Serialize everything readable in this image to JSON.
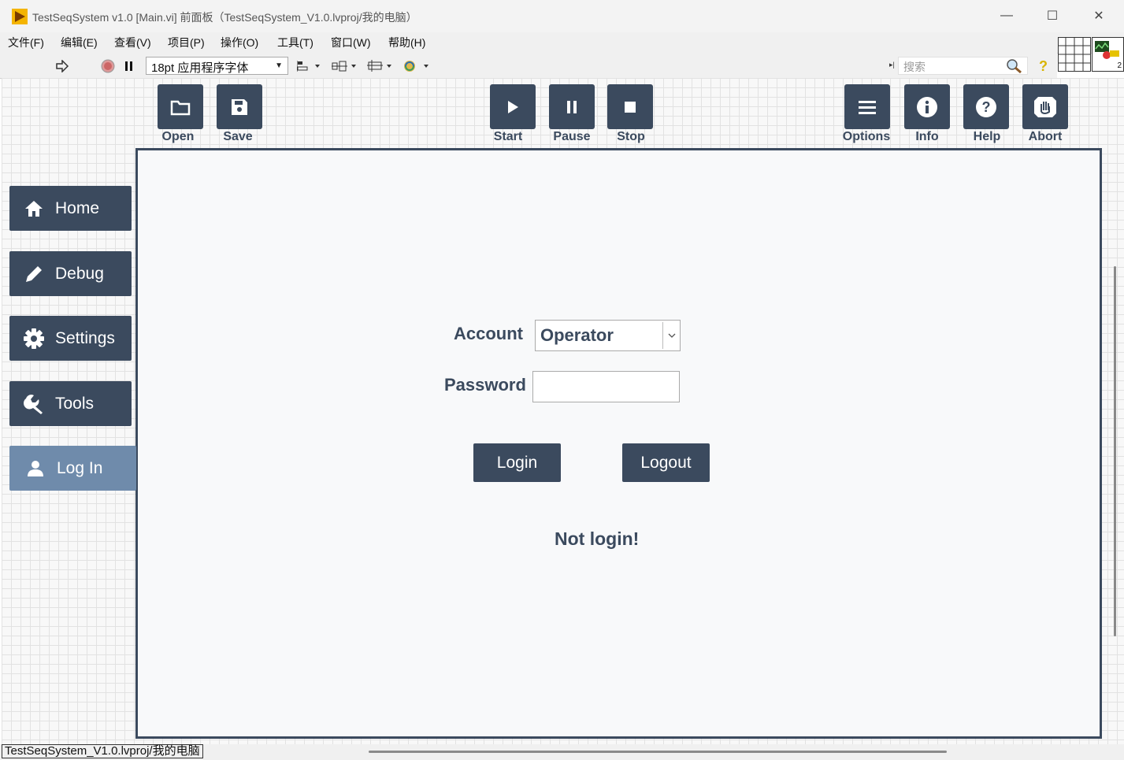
{
  "window": {
    "title": "TestSeqSystem v1.0 [Main.vi] 前面板（TestSeqSystem_V1.0.lvproj/我的电脑）",
    "controls": {
      "minimize": "—",
      "maximize": "☐",
      "close": "✕"
    }
  },
  "menu": [
    "文件(F)",
    "编辑(E)",
    "查看(V)",
    "项目(P)",
    "操作(O)",
    "工具(T)",
    "窗口(W)",
    "帮助(H)"
  ],
  "toolbar": {
    "font": "18pt 应用程序字体",
    "search_placeholder": "搜索",
    "icons": [
      "run-arrow-icon",
      "abort-icon",
      "pause-icon",
      "align-icon",
      "distribute-icon",
      "resize-icon",
      "reorder-icon",
      "search-icon",
      "help-icon"
    ]
  },
  "vi_icon_number": "2",
  "top_buttons": [
    {
      "label": "Open",
      "icon": "folder-icon"
    },
    {
      "label": "Save",
      "icon": "save-icon"
    },
    {
      "label": "Start",
      "icon": "play-icon"
    },
    {
      "label": "Pause",
      "icon": "pause-icon"
    },
    {
      "label": "Stop",
      "icon": "stop-icon"
    },
    {
      "label": "Options",
      "icon": "menu-icon"
    },
    {
      "label": "Info",
      "icon": "info-icon"
    },
    {
      "label": "Help",
      "icon": "question-icon"
    },
    {
      "label": "Abort",
      "icon": "hand-icon"
    }
  ],
  "nav": [
    {
      "label": "Home",
      "icon": "home-icon",
      "active": false
    },
    {
      "label": "Debug",
      "icon": "pencil-icon",
      "active": false
    },
    {
      "label": "Settings",
      "icon": "gear-icon",
      "active": false
    },
    {
      "label": "Tools",
      "icon": "wrench-icon",
      "active": false
    },
    {
      "label": "Log In",
      "icon": "user-icon",
      "active": true
    }
  ],
  "login": {
    "account_label": "Account",
    "account_value": "Operator",
    "password_label": "Password",
    "password_value": "",
    "login_button": "Login",
    "logout_button": "Logout",
    "status": "Not login!"
  },
  "statusbar": {
    "path": "TestSeqSystem_V1.0.lvproj/我的电脑"
  },
  "colors": {
    "primary": "#3b4a5e",
    "active_nav": "#6f8bab",
    "panel_bg": "#f8f9fa"
  }
}
